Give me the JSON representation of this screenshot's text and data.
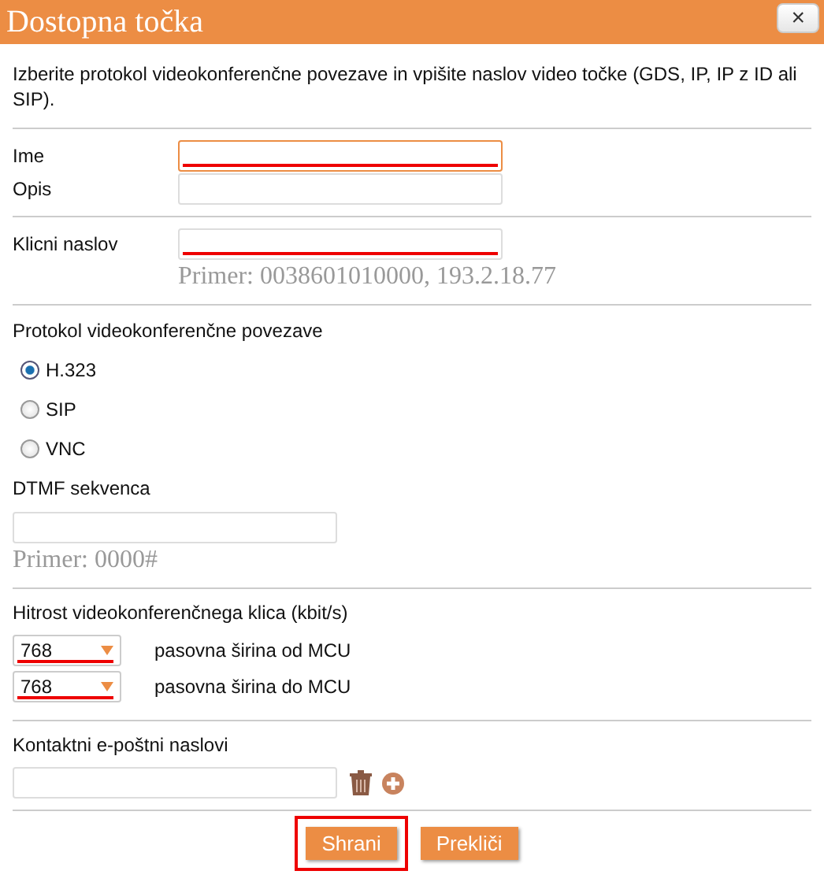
{
  "window": {
    "title": "Dostopna točka",
    "close": "×"
  },
  "intro": "Izberite protokol videokonferenčne povezave in vpišite naslov video točke (GDS, IP, IP z ID ali SIP).",
  "fields": [
    {
      "label": "Ime",
      "highlighted": true,
      "focused": true
    },
    {
      "label": "Opis",
      "highlighted": false,
      "focused": false
    }
  ],
  "address": {
    "label": "Klicni naslov",
    "highlighted": true,
    "hint": "Primer: 0038601010000, 193.2.18.77"
  },
  "protocol": {
    "label": "Protokol videokonferenčne povezave",
    "options": [
      {
        "label": "H.323",
        "selected": true
      },
      {
        "label": "SIP",
        "selected": false
      },
      {
        "label": "VNC",
        "selected": false
      }
    ]
  },
  "dtmf": {
    "label": "DTMF sekvenca",
    "hint": "Primer: 0000#"
  },
  "speed": {
    "label": "Hitrost videokonferenčnega klica (kbit/s)",
    "rows": [
      {
        "value": "768",
        "label": "pasovna širina od MCU",
        "highlighted": true
      },
      {
        "value": "768",
        "label": "pasovna širina do MCU",
        "highlighted": true
      }
    ]
  },
  "contacts": {
    "label": "Kontaktni e-poštni naslovi"
  },
  "buttons": [
    {
      "label": "Shrani",
      "highlighted": true
    },
    {
      "label": "Prekliči",
      "highlighted": false
    }
  ]
}
